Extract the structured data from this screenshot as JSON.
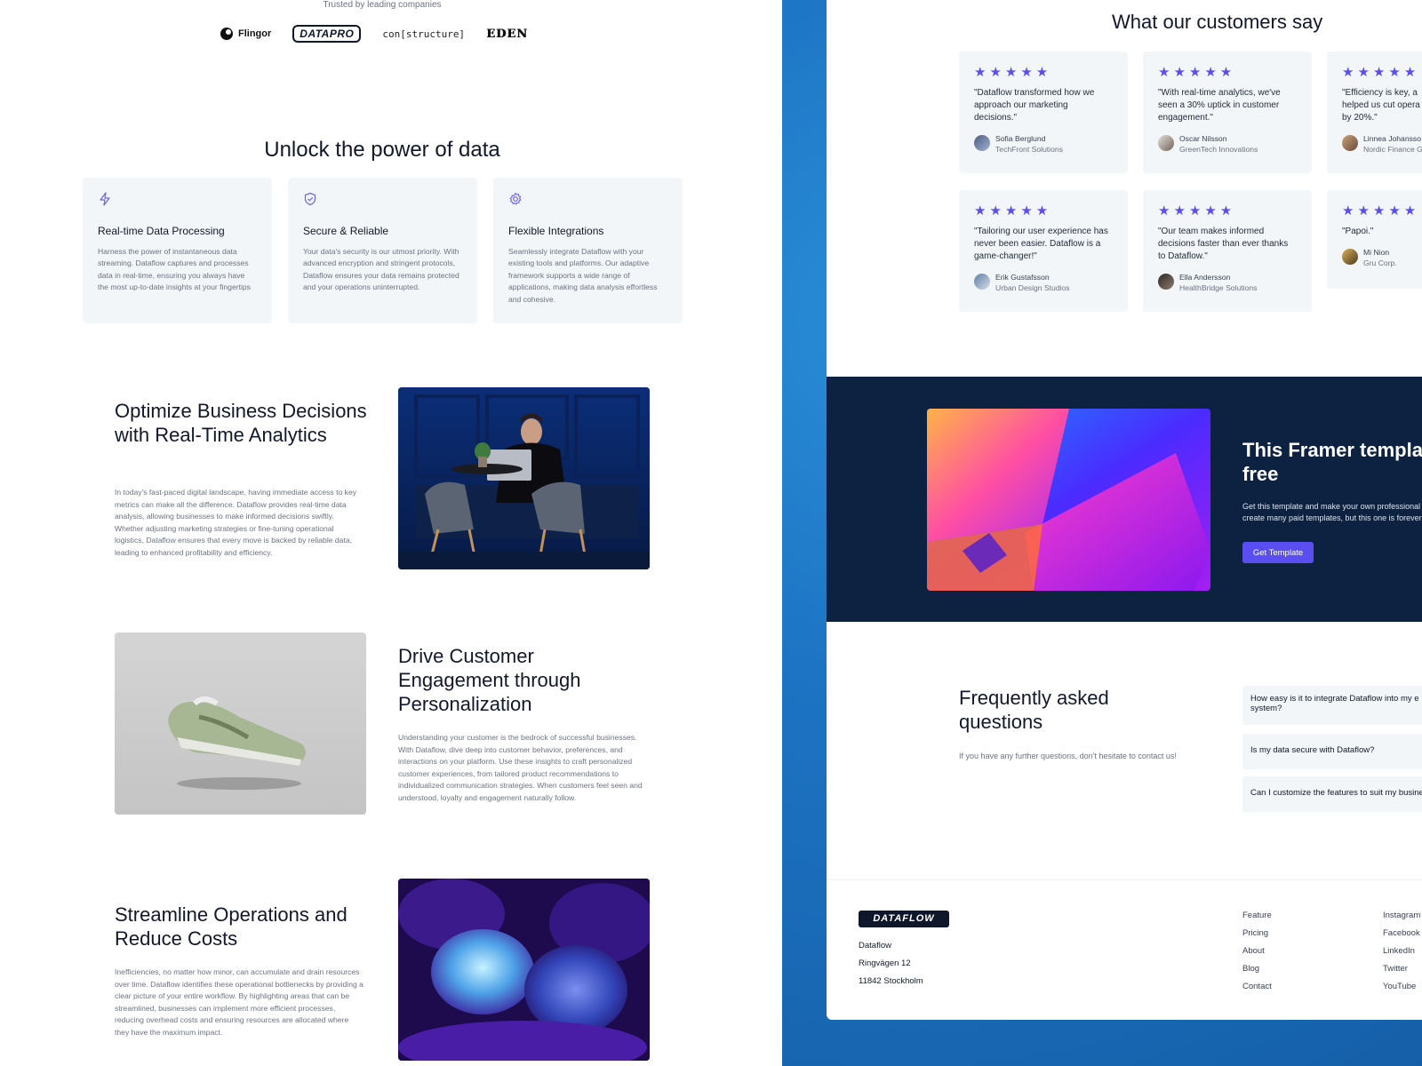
{
  "left": {
    "trusted_label": "Trusted by leading companies",
    "logos": [
      "Flingor",
      "DATAPRO",
      "con[structure]",
      "EDEN"
    ],
    "section_title": "Unlock the power of data",
    "features": [
      {
        "icon": "lightning-icon",
        "title": "Real-time Data Processing",
        "desc": "Harness the power of instantaneous data streaming. Dataflow captures and processes data in real-time, ensuring you always have the most up-to-date insights at your fingertips"
      },
      {
        "icon": "shield-icon",
        "title": "Secure & Reliable",
        "desc": "Your data's security is our utmost priority. With advanced encryption and stringent protocols, Dataflow ensures your data remains protected and your operations uninterrupted."
      },
      {
        "icon": "gear-icon",
        "title": "Flexible Integrations",
        "desc": "Seamlessly integrate Dataflow with your existing tools and platforms. Our adaptive framework supports a wide range of applications, making data analysis effortless and cohesive."
      }
    ],
    "blocks": [
      {
        "title": "Optimize Business Decisions with Real-Time Analytics",
        "text": "In today's fast-paced digital landscape, having immediate access to key metrics can make all the difference. Dataflow provides real-time data analysis, allowing businesses to make informed decisions swiftly. Whether adjusting marketing strategies or fine-tuning operational logistics, Dataflow ensures that every move is backed by reliable data, leading to enhanced profitability and efficiency."
      },
      {
        "title": "Drive Customer Engagement through Personalization",
        "text": "Understanding your customer is the bedrock of successful businesses. With Dataflow, dive deep into customer behavior, preferences, and interactions on your platform. Use these insights to craft personalized customer experiences, from tailored product recommendations to individualized communication strategies. When customers feel seen and understood, loyalty and engagement naturally follow."
      },
      {
        "title": "Streamline Operations and Reduce Costs",
        "text": "Inefficiencies, no matter how minor, can accumulate and drain resources over time. Dataflow identifies these operational bottlenecks by providing a clear picture of your entire workflow. By highlighting areas that can be streamlined, businesses can implement more efficient processes, reducing overhead costs and ensuring resources are allocated where they have the maximum impact."
      }
    ]
  },
  "right": {
    "customers_title": "What our customers say",
    "stars": "★★★★★",
    "testimonials": [
      {
        "quote": "\"Dataflow transformed how we approach our marketing decisions.\"",
        "name": "Sofia Berglund",
        "company": "TechFront Solutions"
      },
      {
        "quote": "\"With real-time analytics, we've seen a 30% uptick in customer engagement.\"",
        "name": "Oscar Nilsson",
        "company": "GreenTech Innovations"
      },
      {
        "quote": "\"Efficiency is key, a helped us cut opera by 20%.\"",
        "name": "Linnea Johansso",
        "company": "Nordic Finance G"
      },
      {
        "quote": "\"Tailoring our user experience has never been easier. Dataflow is a game-changer!\"",
        "name": "Erik Gustafsson",
        "company": "Urban Design Studios"
      },
      {
        "quote": "\"Our team makes informed decisions faster than ever thanks to Dataflow.\"",
        "name": "Ella Andersson",
        "company": "HealthBridge Solutions"
      },
      {
        "quote": "\"Papoi.\"",
        "name": "Mi Nion",
        "company": "Gru Corp."
      }
    ],
    "cta": {
      "title_line1": "This Framer templa",
      "title_line2": "free",
      "text_line1": "Get this template and make your own professional w",
      "text_line2": "create many paid templates, but this one is forever fr",
      "button": "Get Template"
    },
    "faq": {
      "title": "Frequently asked questions",
      "subtitle": "If you have any further questions, don't hesitate to contact us!",
      "items": [
        {
          "line1": "How easy is it to integrate Dataflow into my e",
          "line2": "system?"
        },
        {
          "line1": "Is my data secure with Dataflow?",
          "line2": ""
        },
        {
          "line1": "Can I customize the features to suit my busine",
          "line2": ""
        }
      ]
    },
    "footer": {
      "logo": "DATAFLOW",
      "address": [
        "Dataflow",
        "Ringvägen 12",
        "11842 Stockholm"
      ],
      "links_col1": [
        "Feature",
        "Pricing",
        "About",
        "Blog",
        "Contact"
      ],
      "links_col2": [
        "Instagram",
        "Facebook",
        "LinkedIn",
        "Twitter",
        "YouTube"
      ]
    }
  },
  "colors": {
    "accent": "#5b4ef0",
    "navy": "#0d2240",
    "card_bg": "#f3f6f9",
    "desktop_blue": "#1d74c4"
  }
}
